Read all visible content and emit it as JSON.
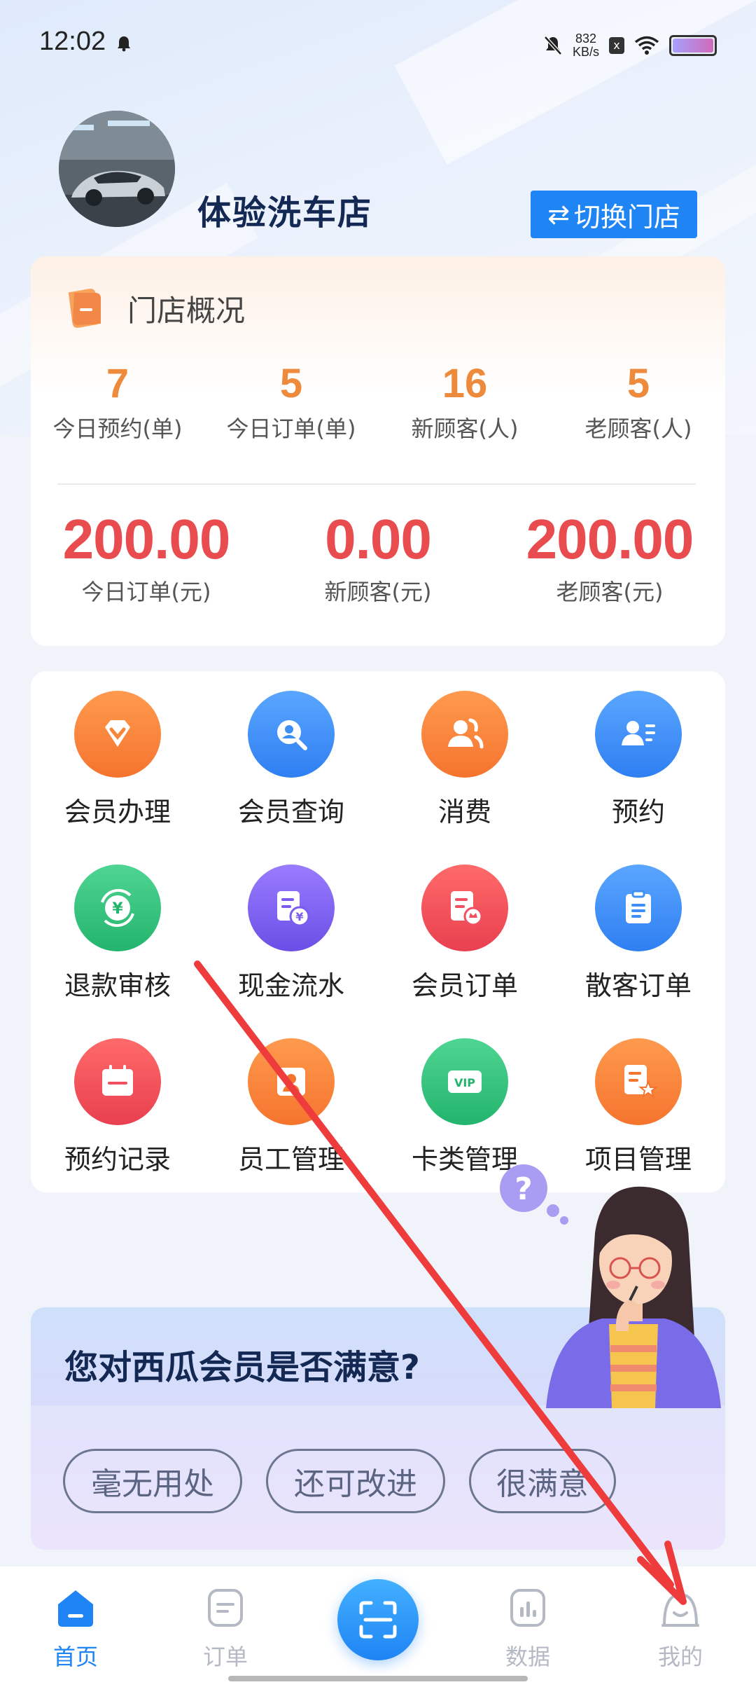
{
  "status_bar": {
    "time": "12:02",
    "speed_value": "832",
    "speed_unit": "KB/s",
    "x_badge": "x"
  },
  "header": {
    "shop_name": "体验洗车店",
    "switch_label": "切换门店",
    "switch_icon": "⇄"
  },
  "overview": {
    "title": "门店概况",
    "stats": [
      {
        "value": "7",
        "label": "今日预约(单)"
      },
      {
        "value": "5",
        "label": "今日订单(单)"
      },
      {
        "value": "16",
        "label": "新顾客(人)"
      },
      {
        "value": "5",
        "label": "老顾客(人)"
      }
    ],
    "money": [
      {
        "value": "200.00",
        "label": "今日订单(元)"
      },
      {
        "value": "0.00",
        "label": "新顾客(元)"
      },
      {
        "value": "200.00",
        "label": "老顾客(元)"
      }
    ]
  },
  "menu": {
    "items": [
      {
        "label": "会员办理",
        "icon": "diamond-icon",
        "color": "#f9823a"
      },
      {
        "label": "会员查询",
        "icon": "member-search-icon",
        "color": "#3d8ff5"
      },
      {
        "label": "消费",
        "icon": "users-icon",
        "color": "#f9823a"
      },
      {
        "label": "预约",
        "icon": "contact-card-icon",
        "color": "#3d8ff5"
      },
      {
        "label": "退款审核",
        "icon": "refund-icon",
        "color": "#32c47c"
      },
      {
        "label": "现金流水",
        "icon": "cash-document-icon",
        "color": "#7a5cf0"
      },
      {
        "label": "会员订单",
        "icon": "member-order-icon",
        "color": "#f05060"
      },
      {
        "label": "散客订单",
        "icon": "clipboard-icon",
        "color": "#3d8ff5"
      },
      {
        "label": "预约记录",
        "icon": "calendar-icon",
        "color": "#f05060"
      },
      {
        "label": "员工管理",
        "icon": "staff-icon",
        "color": "#f9823a"
      },
      {
        "label": "卡类管理",
        "icon": "vip-card-icon",
        "color": "#32c47c"
      },
      {
        "label": "项目管理",
        "icon": "project-star-icon",
        "color": "#f9823a"
      }
    ],
    "vip_text": "VIP"
  },
  "survey": {
    "question": "您对西瓜会员是否满意?",
    "options": [
      "毫无用处",
      "还可改进",
      "很满意"
    ],
    "bubble_mark": "?"
  },
  "nav": {
    "items": [
      {
        "label": "首页",
        "icon": "home-icon",
        "active": true
      },
      {
        "label": "订单",
        "icon": "order-icon",
        "active": false
      },
      {
        "label": "数据",
        "icon": "chart-icon",
        "active": false
      },
      {
        "label": "我的",
        "icon": "profile-icon",
        "active": false
      }
    ]
  },
  "colors": {
    "accent": "#1f84f4",
    "orange_num": "#ee8a3c",
    "red_num": "#e84c4e",
    "title_navy": "#132852"
  }
}
